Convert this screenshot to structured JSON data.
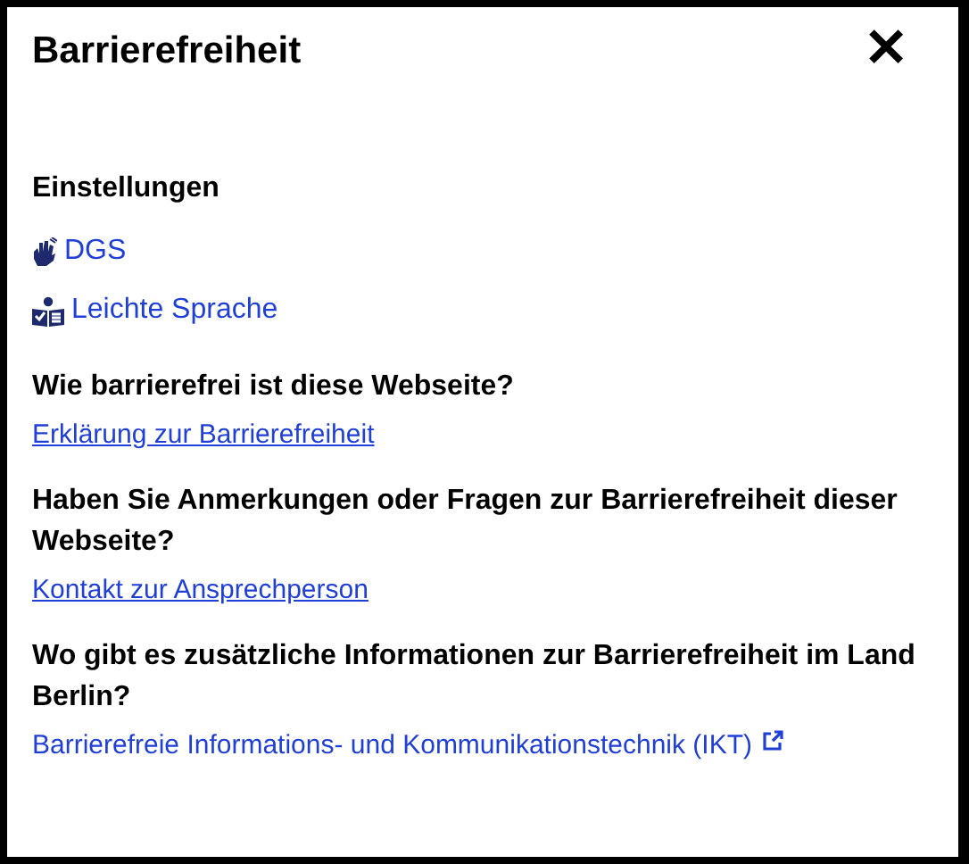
{
  "dialog": {
    "title": "Barrierefreiheit",
    "close": "✕"
  },
  "settings": {
    "heading": "Einstellungen",
    "items": [
      {
        "kind": "sign",
        "label": "DGS"
      },
      {
        "kind": "easy",
        "label": "Leichte Sprache"
      }
    ]
  },
  "sections": [
    {
      "question": "Wie barrierefrei ist diese Webseite?",
      "link": {
        "kind": "page",
        "label": "Erklärung zur Barrierefreiheit"
      }
    },
    {
      "question": "Haben Sie Anmerkungen oder Fragen zur Barrierefreiheit dieser Webseite?",
      "link": {
        "kind": "page",
        "label": "Kontakt zur Ansprechperson"
      }
    },
    {
      "question": "Wo gibt es zusätzliche Informationen zur Barrierefreiheit im Land Berlin?",
      "link": {
        "kind": "external",
        "label": "Barrierefreie Informations- und Kommunikationstechnik (IKT)"
      }
    }
  ]
}
